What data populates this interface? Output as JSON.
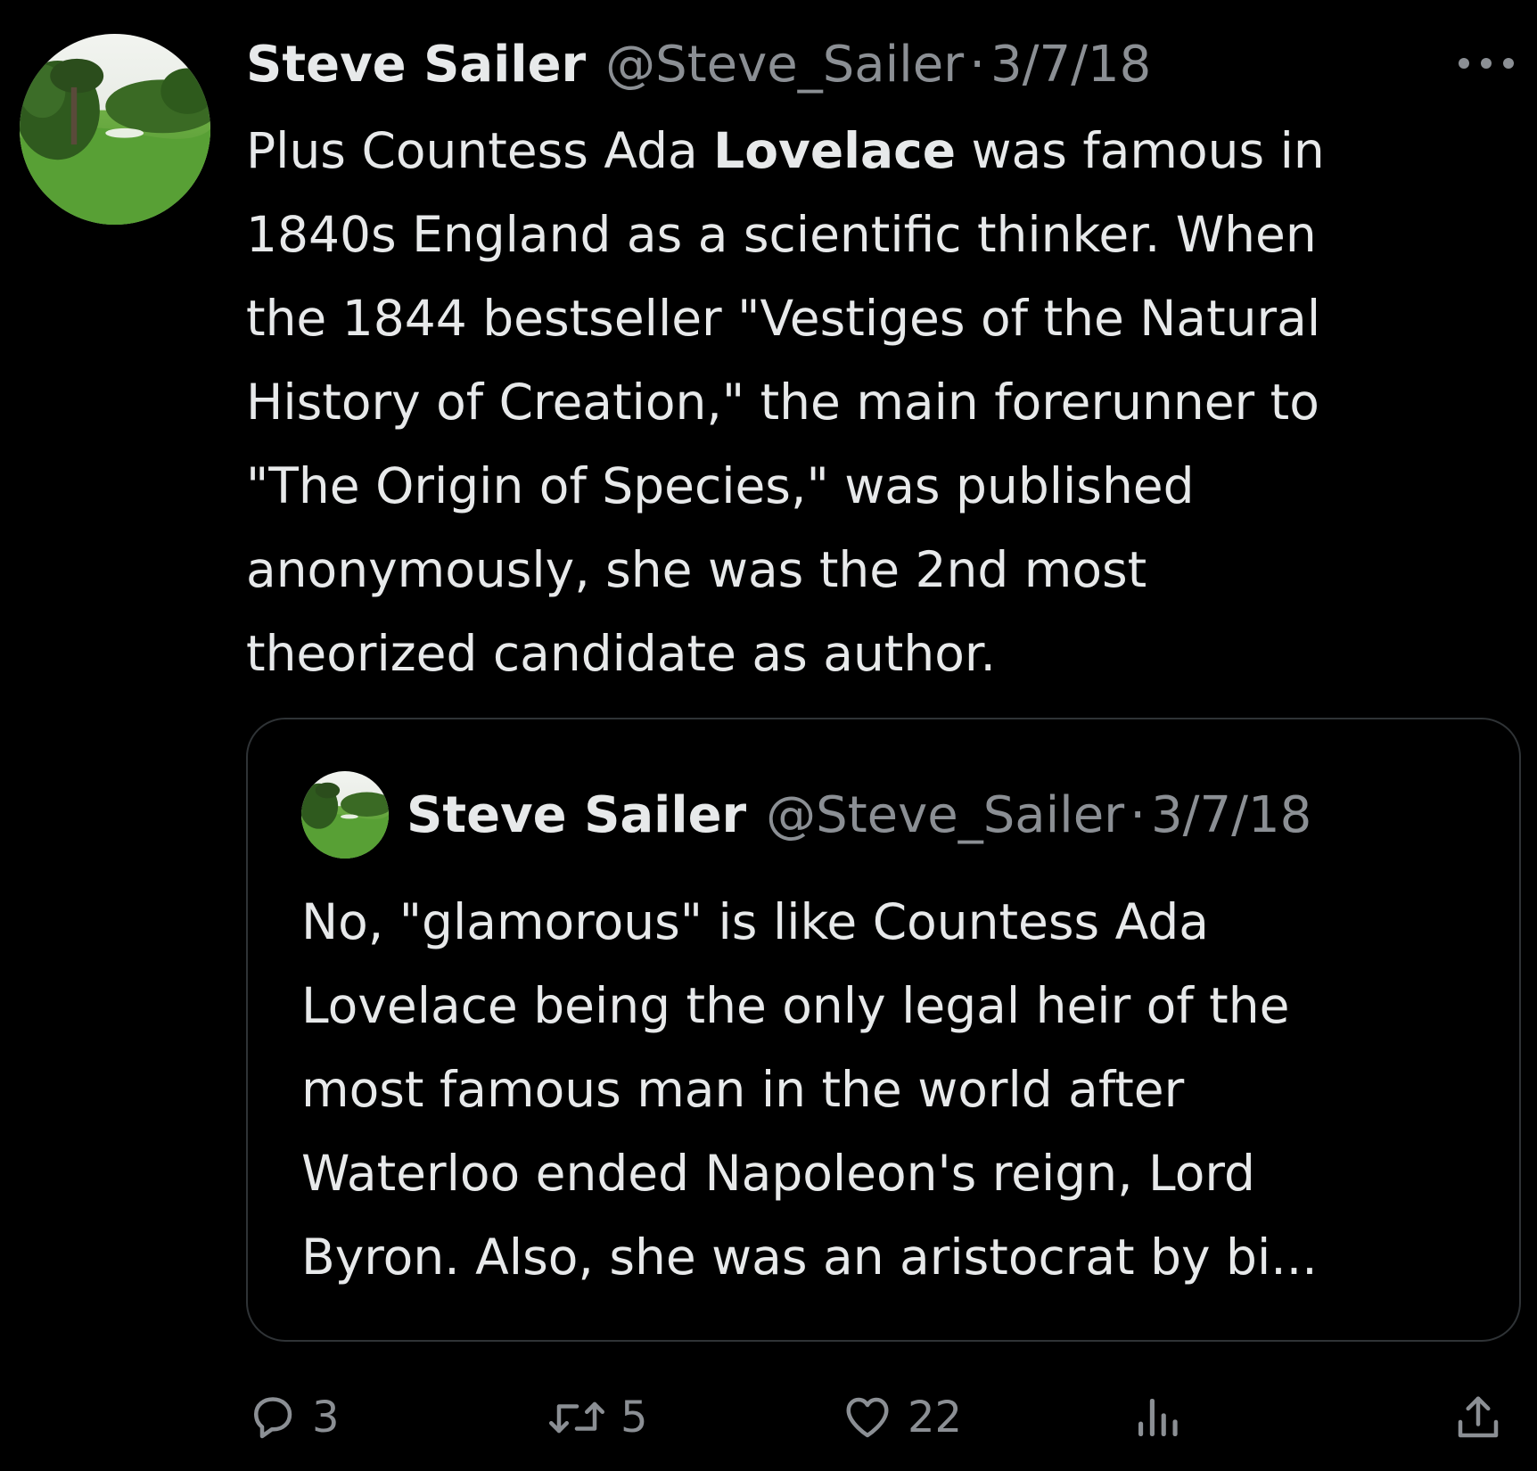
{
  "tweet": {
    "author_name": "Steve Sailer",
    "handle": "@Steve_Sailer",
    "separator": "·",
    "date": "3/7/18",
    "text_before": "Plus Countess Ada ",
    "text_bold": "Lovelace",
    "text_after": " was famous in\n1840s England as a scientific thinker. When\nthe 1844 bestseller \"Vestiges of the Natural\nHistory of Creation,\" the main forerunner to\n\"The Origin of Species,\" was published\nanonymously, she was the 2nd most\ntheorized candidate as author."
  },
  "quote": {
    "author_name": "Steve Sailer",
    "handle": "@Steve_Sailer",
    "separator": "·",
    "date": "3/7/18",
    "text": "No, \"glamorous\" is like Countess Ada\nLovelace being the only legal heir of the\nmost famous man in the world after\nWaterloo ended Napoleon's reign, Lord\nByron. Also, she was an aristocrat by bi..."
  },
  "actions": {
    "replies": "3",
    "retweets": "5",
    "likes": "22"
  },
  "colors": {
    "background": "#000000",
    "text": "#e7e9ea",
    "secondary": "#8b8f94",
    "border": "#2f3336"
  },
  "icons": [
    "more-icon",
    "reply-icon",
    "retweet-icon",
    "like-icon",
    "views-icon",
    "share-icon"
  ]
}
